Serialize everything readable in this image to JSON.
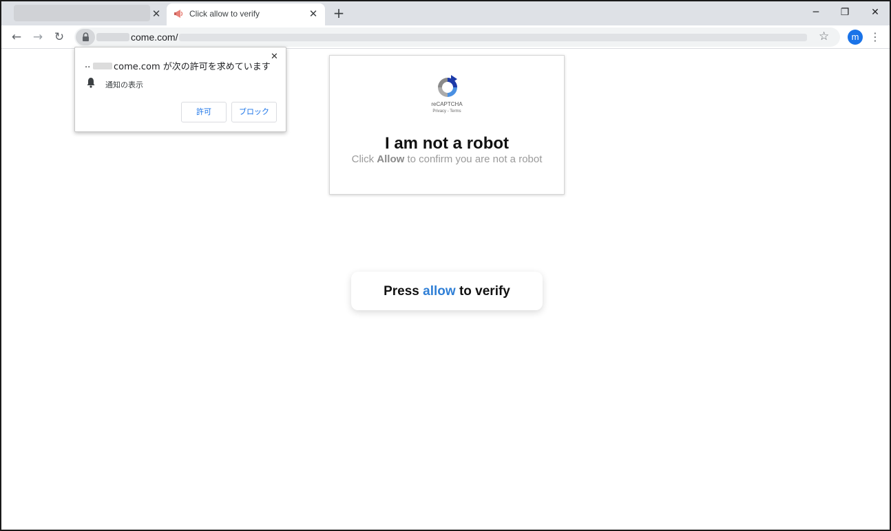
{
  "browser": {
    "tabs": [
      {
        "title": "",
        "active": false
      },
      {
        "title": "Click allow to verify",
        "active": true
      }
    ],
    "new_tab_icon": "plus-icon",
    "window_controls": {
      "minimize": "─",
      "restore": "❐",
      "close": "✕"
    },
    "address_bar": {
      "url_visible": "come.com/",
      "lock_icon": "lock-icon"
    },
    "profile_initial": "m",
    "accent_color": "#1a73e8"
  },
  "permission_popup": {
    "prefix": "..",
    "message": "come.com が次の許可を求めています",
    "item": "通知の表示",
    "allow_label": "許可",
    "block_label": "ブロック",
    "close_label": "✕"
  },
  "captcha": {
    "logo_label": "reCAPTCHA",
    "links": "Privacy - Terms",
    "heading": "I am not a robot",
    "sub_pre": "Click ",
    "sub_bold": "Allow",
    "sub_post": " to confirm you are not a robot"
  },
  "press_box": {
    "pre": "Press ",
    "accent": "allow",
    "post": " to verify",
    "accent_color": "#2f7fd6"
  }
}
